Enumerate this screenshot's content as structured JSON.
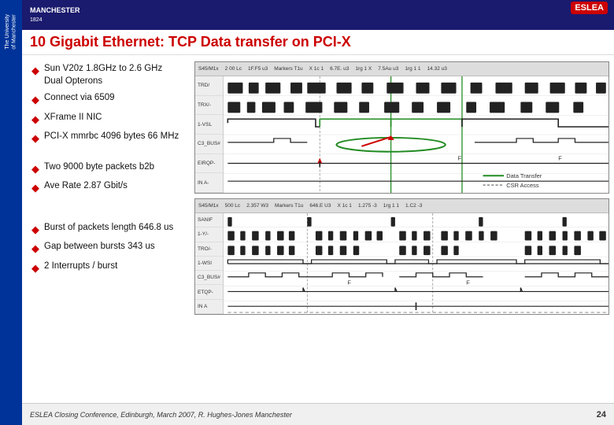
{
  "page": {
    "title": "10 Gigabit Ethernet: TCP Data transfer on PCI-X",
    "page_number": "24",
    "footer_text": "ESLEA Closing Conference, Edinburgh, March 2007,  R. Hughes-Jones  Manchester"
  },
  "sidebar": {
    "university_line1": "The University",
    "university_line2": "of Manchester"
  },
  "header": {
    "manchester_name": "MANCHESTER",
    "manchester_year": "1824",
    "eslea_label": "ESLEA"
  },
  "bullet_groups": [
    {
      "items": [
        "Sun V20z 1.8GHz to 2.6 GHz Dual Opterons",
        "Connect via 6509",
        "XFrame II NIC",
        "PCI-X mmrbc 4096 bytes 66 MHz"
      ]
    },
    {
      "items": [
        "Two 9000 byte packets b2b",
        "Ave Rate 2.87 Gbit/s"
      ]
    },
    {
      "items": [
        "Burst of packets length 646.8 us",
        "Gap between bursts 343 us",
        "2 Interrupts / burst"
      ]
    }
  ],
  "scope_top": {
    "header_items": [
      "S45/M1x",
      "2 00 Lc",
      "1F.F5 U3",
      "Markers T1u",
      "X 1c 1",
      "6.7E. U3",
      "1rg 1 X",
      "7.5Au U3",
      "1rg 1 1",
      "14.32 U3"
    ],
    "labels": [
      "TRD/",
      "TRX/-",
      "1-VSL",
      "C3_BUS#",
      "EIRQP-",
      "IN A-"
    ],
    "legend": {
      "solid_label": "Data Transfer",
      "dotted_label": "CSR Access"
    }
  },
  "scope_bottom": {
    "header_items": [
      "S45/M1x",
      "500 Lc",
      "2.357 W3",
      "Markers T1u",
      "646.E U3",
      "X 1c 1",
      "1.275 -3",
      "1rg 1 1",
      "1.C2 -3"
    ],
    "labels": [
      "SANIF",
      "1-Y/-",
      "TRO/-",
      "1-WSI",
      "C3_BUS#",
      "ETQP-",
      "IN A"
    ]
  }
}
